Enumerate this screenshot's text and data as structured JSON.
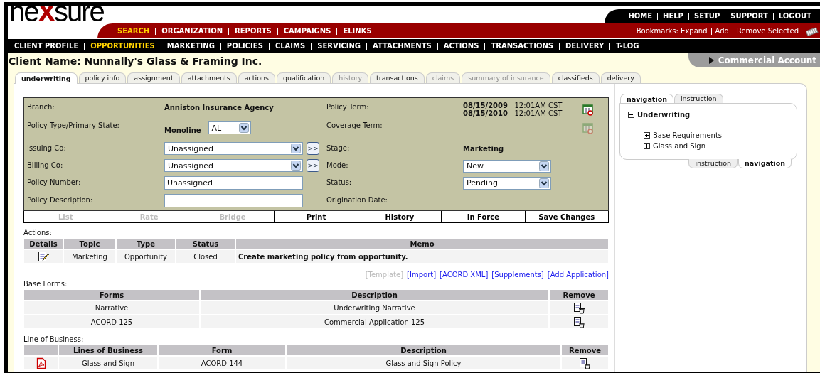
{
  "logo": "ne**x**sure",
  "top_links": [
    "HOME",
    "HELP",
    "SETUP",
    "SUPPORT",
    "LOGOUT"
  ],
  "main_menu": [
    {
      "label": "SEARCH",
      "selected": true
    },
    {
      "label": "ORGANIZATION",
      "selected": false
    },
    {
      "label": "REPORTS",
      "selected": false
    },
    {
      "label": "CAMPAIGNS",
      "selected": false
    },
    {
      "label": "ELINKS",
      "selected": false
    }
  ],
  "bookmarks": [
    "Bookmarks: Expand",
    "Add",
    "Remove Selected"
  ],
  "sub_menu": [
    {
      "label": "CLIENT PROFILE",
      "selected": false
    },
    {
      "label": "OPPORTUNITIES",
      "selected": true
    },
    {
      "label": "MARKETING",
      "selected": false
    },
    {
      "label": "POLICIES",
      "selected": false
    },
    {
      "label": "CLAIMS",
      "selected": false
    },
    {
      "label": "SERVICING",
      "selected": false
    },
    {
      "label": "ATTACHMENTS",
      "selected": false
    },
    {
      "label": "ACTIONS",
      "selected": false
    },
    {
      "label": "TRANSACTIONS",
      "selected": false
    },
    {
      "label": "DELIVERY",
      "selected": false
    },
    {
      "label": "T-LOG",
      "selected": false
    }
  ],
  "client_name": "Client Name: Nunnally's Glass & Framing Inc.",
  "account_type": "Commercial Account",
  "tabs": [
    {
      "label": "underwriting",
      "selected": true,
      "disabled": false
    },
    {
      "label": "policy info",
      "selected": false,
      "disabled": false
    },
    {
      "label": "assignment",
      "selected": false,
      "disabled": false
    },
    {
      "label": "attachments",
      "selected": false,
      "disabled": false
    },
    {
      "label": "actions",
      "selected": false,
      "disabled": false
    },
    {
      "label": "qualification",
      "selected": false,
      "disabled": false
    },
    {
      "label": "history",
      "selected": false,
      "disabled": true
    },
    {
      "label": "transactions",
      "selected": false,
      "disabled": false
    },
    {
      "label": "claims",
      "selected": false,
      "disabled": true
    },
    {
      "label": "summary of insurance",
      "selected": false,
      "disabled": true
    },
    {
      "label": "classifieds",
      "selected": false,
      "disabled": false
    },
    {
      "label": "delivery",
      "selected": false,
      "disabled": false
    }
  ],
  "form": {
    "rows": [
      {
        "left": {
          "label": "Branch:",
          "kind": "text",
          "value": "Anniston Insurance Agency"
        },
        "right": {
          "label": "Policy Term:",
          "kind": "dates",
          "disabled": false,
          "dates": [
            {
              "date": "08/15/2009",
              "time": "12:01AM CST"
            },
            {
              "date": "08/15/2010",
              "time": "12:01AM CST"
            }
          ]
        }
      },
      {
        "left": {
          "label": "Policy Type/Primary State:",
          "kind": "type_state",
          "value": "Monoline",
          "select": "AL"
        },
        "right": {
          "label": "Coverage Term:",
          "kind": "dates",
          "disabled": true
        }
      },
      {
        "left": {
          "label": "Issuing Co:",
          "kind": "select_go",
          "value": "Unassigned",
          "action": ">>"
        },
        "right": {
          "label": "Stage:",
          "kind": "text",
          "value": "Marketing"
        }
      },
      {
        "left": {
          "label": "Billing Co:",
          "kind": "select_go",
          "value": "Unassigned",
          "action": ">>"
        },
        "right": {
          "label": "Mode:",
          "kind": "select",
          "value": "New"
        }
      },
      {
        "left": {
          "label": "Policy Number:",
          "kind": "input",
          "value": "Unassigned"
        },
        "right": {
          "label": "Status:",
          "kind": "select",
          "value": "Pending"
        }
      },
      {
        "left": {
          "label": "Policy Description:",
          "kind": "input"
        },
        "right": {
          "label": "Origination Date:",
          "kind": "text"
        }
      }
    ],
    "buttons": [
      {
        "label": "List",
        "disabled": true
      },
      {
        "label": "Rate",
        "disabled": true
      },
      {
        "label": "Bridge",
        "disabled": true
      },
      {
        "label": "Print",
        "disabled": false
      },
      {
        "label": "History",
        "disabled": false
      },
      {
        "label": "In Force",
        "disabled": false
      },
      {
        "label": "Save Changes",
        "disabled": false
      }
    ]
  },
  "actions": {
    "label": "Actions:",
    "columns": [
      "Details",
      "Topic",
      "Type",
      "Status",
      "Memo"
    ],
    "rows": [
      {
        "cells": [
          "",
          "Marketing",
          "Opportunity",
          "Closed",
          "Create marketing policy from opportunity."
        ]
      }
    ]
  },
  "links": [
    {
      "label": "[Template]",
      "disabled": true
    },
    {
      "label": "[Import]",
      "disabled": false
    },
    {
      "label": "[ACORD XML]",
      "disabled": false
    },
    {
      "label": "[Supplements]",
      "disabled": false
    },
    {
      "label": "[Add Application]",
      "disabled": false
    }
  ],
  "base_forms": {
    "label": "Base Forms:",
    "columns": [
      "Forms",
      "Description",
      "Remove"
    ],
    "rows": [
      {
        "cells": [
          "Narrative",
          "Underwriting Narrative"
        ]
      },
      {
        "cells": [
          "ACORD 125",
          "Commercial Application 125"
        ]
      }
    ]
  },
  "line_of_business": {
    "label": "Line of Business:",
    "columns": [
      "",
      "Lines of Business",
      "Form",
      "Description",
      "Remove"
    ],
    "rows": [
      {
        "cells": [
          "",
          "Glass and Sign",
          "ACORD 144",
          "Glass and Sign Policy"
        ]
      }
    ]
  },
  "navigation": {
    "top_tabs": [
      {
        "label": "navigation",
        "selected": true
      },
      {
        "label": "instruction",
        "selected": false
      }
    ],
    "tree": {
      "label": "Underwriting",
      "expanded": true,
      "children": [
        {
          "label": "Base Requirements",
          "expanded": false
        },
        {
          "label": "Glass and Sign",
          "expanded": false
        }
      ]
    },
    "bottom_tabs": [
      {
        "label": "instruction",
        "selected": false
      },
      {
        "label": "navigation",
        "selected": true
      }
    ]
  }
}
